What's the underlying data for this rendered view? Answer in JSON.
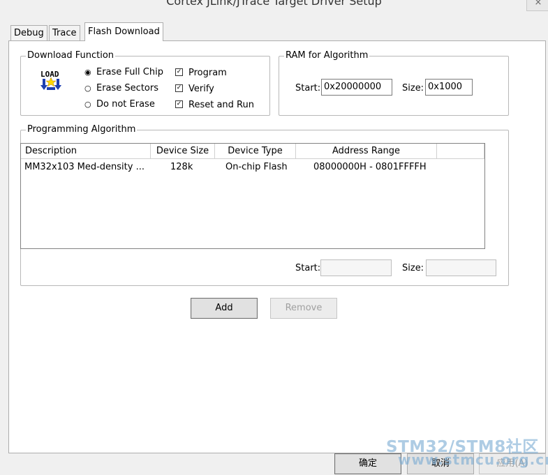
{
  "window": {
    "title": "Cortex JLink/JTrace Target Driver Setup",
    "close_glyph": "×"
  },
  "tabs": [
    {
      "label": "Debug"
    },
    {
      "label": "Trace"
    },
    {
      "label": "Flash Download"
    }
  ],
  "download_function": {
    "legend": "Download Function",
    "icon": "load-icon",
    "icon_text": "LOAD",
    "radios": [
      {
        "label": "Erase Full Chip",
        "checked": true
      },
      {
        "label": "Erase Sectors",
        "checked": false
      },
      {
        "label": "Do not Erase",
        "checked": false
      }
    ],
    "checks": [
      {
        "label": "Program",
        "checked": true
      },
      {
        "label": "Verify",
        "checked": true
      },
      {
        "label": "Reset and Run",
        "checked": true
      }
    ]
  },
  "ram": {
    "legend": "RAM for Algorithm",
    "start_label": "Start:",
    "start_value": "0x20000000",
    "size_label": "Size:",
    "size_value": "0x1000"
  },
  "algorithm": {
    "legend": "Programming Algorithm",
    "columns": [
      "Description",
      "Device Size",
      "Device Type",
      "Address Range"
    ],
    "rows": [
      [
        "MM32x103 Med-density ...",
        "128k",
        "On-chip Flash",
        "08000000H - 0801FFFFH"
      ]
    ],
    "start_label": "Start:",
    "start_value": "",
    "size_label": "Size:",
    "size_value": ""
  },
  "buttons": {
    "add": "Add",
    "remove": "Remove"
  },
  "footer": {
    "ok": "确定",
    "cancel": "取消",
    "apply": "应用(A)"
  },
  "watermark": {
    "line1": "STM32/STM8社区",
    "line2": "www.stmcu.org.cn"
  }
}
